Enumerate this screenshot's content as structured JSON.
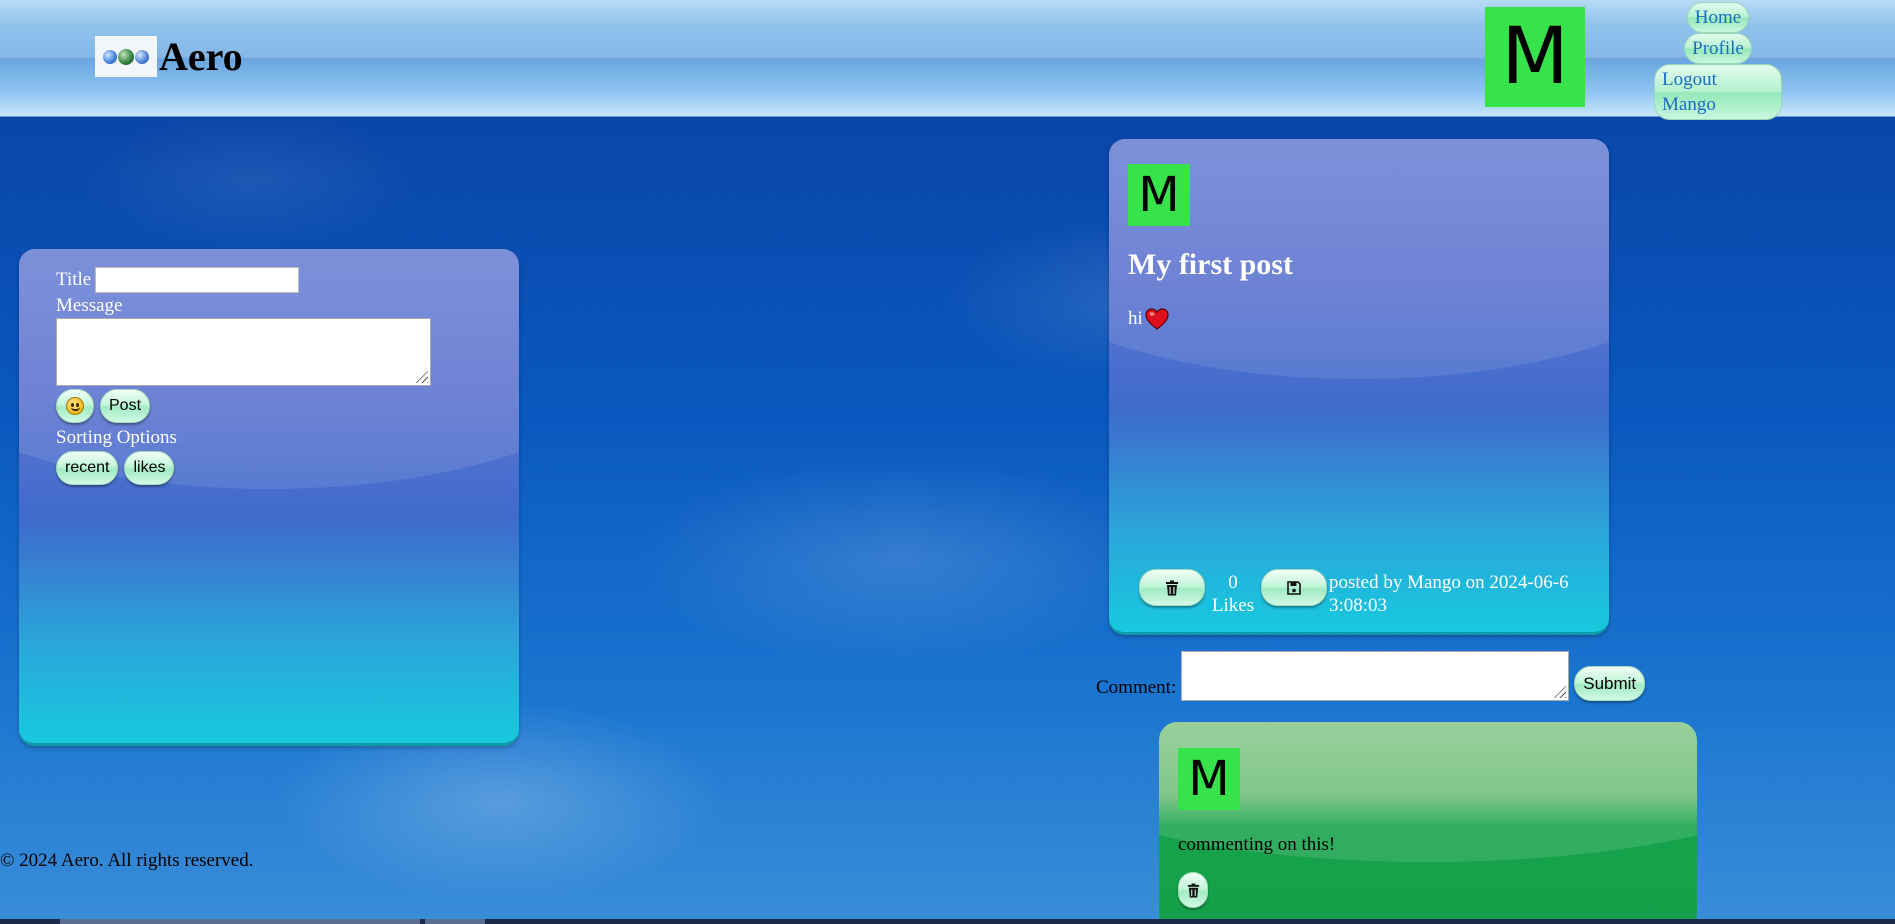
{
  "header": {
    "brand": "Aero",
    "avatar_letter": "M",
    "nav": [
      "Home",
      "Profile",
      "Logout Mango"
    ]
  },
  "compose": {
    "title_label": "Title",
    "title_value": "",
    "message_label": "Message",
    "message_value": "",
    "emoji_icon": "smiley-face-icon",
    "post_button": "Post",
    "sorting_label": "Sorting Options",
    "sort_buttons": [
      "recent",
      "likes"
    ]
  },
  "post": {
    "avatar_letter": "M",
    "title": "My first post",
    "body": "hi",
    "body_icon": "red-heart-icon",
    "delete_icon": "trash-icon",
    "like_count": "0",
    "likes_label": "Likes",
    "save_icon": "floppy-disk-icon",
    "posted_line1": "posted by Mango on 2024-06-6",
    "posted_line2": "3:08:03"
  },
  "comment_form": {
    "label": "Comment:",
    "value": "",
    "submit": "Submit"
  },
  "comment": {
    "avatar_letter": "M",
    "text": "commenting on this!",
    "delete_icon": "trash-icon"
  },
  "footer": {
    "copyright": "© 2024 Aero. All rights reserved."
  },
  "colors": {
    "avatar": "#37e34a",
    "heart": "#e0101e",
    "post_card_top": "#6f85d6",
    "post_card_bottom": "#18c9df",
    "comment_card": "#16a34a"
  }
}
